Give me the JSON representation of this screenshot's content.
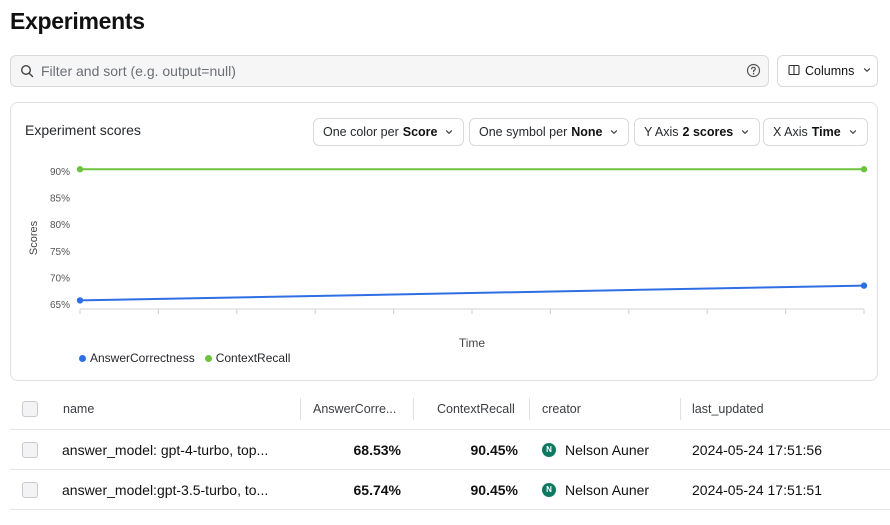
{
  "page": {
    "title": "Experiments"
  },
  "search": {
    "placeholder": "Filter and sort (e.g. output=null)"
  },
  "toolbar": {
    "columns_label": "Columns"
  },
  "chart_panel": {
    "title": "Experiment scores",
    "controls": [
      {
        "prefix": "One color per ",
        "value": "Score"
      },
      {
        "prefix": "One symbol per ",
        "value": "None"
      },
      {
        "prefix": "Y Axis ",
        "value": "2 scores"
      },
      {
        "prefix": "X Axis ",
        "value": "Time"
      }
    ]
  },
  "chart_data": {
    "type": "line",
    "xlabel": "Time",
    "ylabel": "Scores",
    "x": [
      "2024-05-24 17:51:51",
      "2024-05-24 17:51:56"
    ],
    "yticks": [
      "65%",
      "70%",
      "75%",
      "80%",
      "85%",
      "90%"
    ],
    "ylim": [
      64.5,
      92
    ],
    "grid": false,
    "legend_position": "bottom-left",
    "series": [
      {
        "name": "AnswerCorrectness",
        "color": "#2f6fe4",
        "values": [
          65.74,
          68.53
        ]
      },
      {
        "name": "ContextRecall",
        "color": "#6cc33c",
        "values": [
          90.45,
          90.45
        ]
      }
    ]
  },
  "table": {
    "columns": [
      "name",
      "AnswerCorre...",
      "ContextRecall",
      "creator",
      "last_updated"
    ],
    "rows": [
      {
        "name": "answer_model: gpt-4-turbo, top...",
        "answer_correctness": "68.53%",
        "context_recall": "90.45%",
        "creator_initial": "N",
        "creator": "Nelson Auner",
        "last_updated": "2024-05-24 17:51:56"
      },
      {
        "name": "answer_model:gpt-3.5-turbo, to...",
        "answer_correctness": "65.74%",
        "context_recall": "90.45%",
        "creator_initial": "N",
        "creator": "Nelson Auner",
        "last_updated": "2024-05-24 17:51:51"
      }
    ]
  }
}
